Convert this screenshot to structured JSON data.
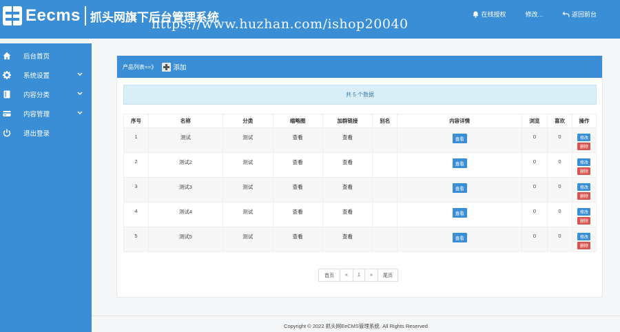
{
  "header": {
    "brand": "Eecms",
    "subtitle": "抓头网旗下后台管理系统",
    "watermark": "https://www.huzhan.com/ishop20040",
    "links": [
      {
        "label": "在线授权",
        "icon": "bell-icon"
      },
      {
        "label": "修改...",
        "icon": "none"
      },
      {
        "label": "返回前台",
        "icon": "undo-arrow-icon"
      }
    ]
  },
  "sidebar": {
    "items": [
      {
        "label": "后台首页",
        "icon": "home-icon",
        "expandable": false
      },
      {
        "label": "系统设置",
        "icon": "gear-icon",
        "expandable": true
      },
      {
        "label": "内容分类",
        "icon": "book-icon",
        "expandable": true
      },
      {
        "label": "内容管理",
        "icon": "credit-card-icon",
        "expandable": true
      },
      {
        "label": "退出登录",
        "icon": "power-icon",
        "expandable": false
      }
    ]
  },
  "panel": {
    "title": "产品列表==》",
    "add_label": "添加",
    "notice": "共 5 个数据"
  },
  "table": {
    "headers": [
      "序号",
      "名称",
      "分类",
      "缩略图",
      "加群链接",
      "别名",
      "内容详情",
      "浏览",
      "喜欢",
      "操作"
    ],
    "view_label": "查看",
    "edit_label": "修改",
    "delete_label": "删除",
    "rows": [
      {
        "id": "1",
        "name": "测试",
        "category": "测试",
        "thumb": "查看",
        "link": "查看",
        "alias": "",
        "views": "0",
        "likes": "0"
      },
      {
        "id": "2",
        "name": "测试2",
        "category": "测试",
        "thumb": "查看",
        "link": "查看",
        "alias": "",
        "views": "0",
        "likes": "0"
      },
      {
        "id": "3",
        "name": "测试3",
        "category": "测试",
        "thumb": "查看",
        "link": "查看",
        "alias": "",
        "views": "0",
        "likes": "0"
      },
      {
        "id": "4",
        "name": "测试4",
        "category": "测试",
        "thumb": "查看",
        "link": "查看",
        "alias": "",
        "views": "0",
        "likes": "0"
      },
      {
        "id": "5",
        "name": "测试5",
        "category": "测试",
        "thumb": "查看",
        "link": "查看",
        "alias": "",
        "views": "0",
        "likes": "0"
      }
    ]
  },
  "pager": {
    "first": "首页",
    "prev": "«",
    "current": "1",
    "next": "»",
    "last": "尾页"
  },
  "footer": {
    "text": "Copyright © 2022 抓头网EeCMS管理系统. All Rights Reserved"
  },
  "colors": {
    "primary": "#3a8ed5",
    "danger": "#d9534f",
    "notice_bg": "#d9eef6"
  }
}
